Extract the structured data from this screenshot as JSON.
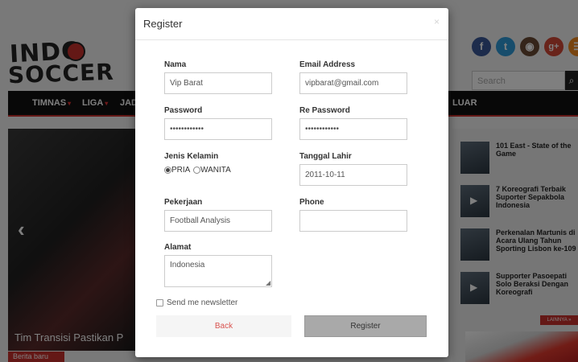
{
  "site": {
    "logo_line1": "INDO",
    "logo_line2": "SOCCER",
    "search_placeholder": "Search",
    "social_icons": [
      "facebook-icon",
      "twitter-icon",
      "instagram-icon",
      "google-plus-icon",
      "rss-icon"
    ],
    "social_glyphs": {
      "facebook": "f",
      "twitter": "t",
      "google_plus": "g+"
    },
    "nav": [
      "TIMNAS",
      "LIGA",
      "JAD",
      "LUAR"
    ],
    "slider_caption": "Tim Transisi Pastikan P",
    "slider_tag": "Berita baru",
    "sidebar_items": [
      "101 East - State of the Game",
      "7 Koreografi Terbaik Suporter Sepakbola Indonesia",
      "Perkenalan Martunis di Acara Ulang Tahun Sporting Lisbon ke-109",
      "Supporter Pasoepati Solo Beraksi Dengan Koreografi"
    ],
    "sidebar_more": "LAINNYA »",
    "colors": {
      "accent": "#c9302c",
      "nav_bg": "#111111"
    }
  },
  "modal": {
    "title": "Register",
    "close": "×",
    "nama": {
      "label": "Nama",
      "value": "Vip Barat"
    },
    "email": {
      "label": "Email Address",
      "value": "vipbarat@gmail.com"
    },
    "password": {
      "label": "Password",
      "value": "••••••••••••"
    },
    "repassword": {
      "label": "Re Password",
      "value": "••••••••••••"
    },
    "gender": {
      "label": "Jenis Kelamin",
      "options": [
        "PRIA",
        "WANITA"
      ],
      "selected": "PRIA"
    },
    "tanggal": {
      "label": "Tanggal Lahir",
      "value": "2011-10-11"
    },
    "pekerjaan": {
      "label": "Pekerjaan",
      "value": "Football Analysis"
    },
    "phone": {
      "label": "Phone",
      "value": ""
    },
    "alamat": {
      "label": "Alamat",
      "value": "Indonesia"
    },
    "newsletter": {
      "label": "Send me newsletter",
      "checked": false
    },
    "back_label": "Back",
    "register_label": "Register",
    "colors": {
      "back_text": "#d9534f",
      "register_bg": "#a9a9a9"
    }
  }
}
